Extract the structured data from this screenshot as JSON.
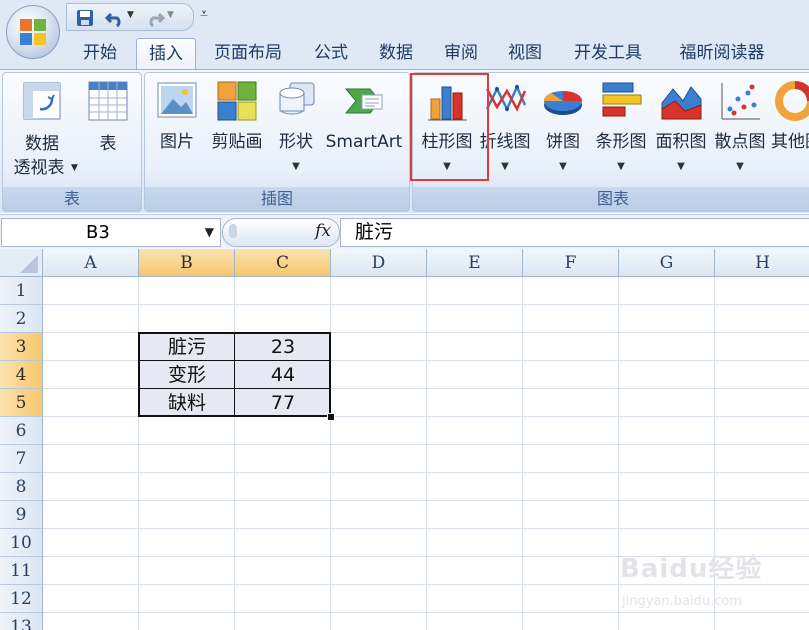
{
  "quick_access": {
    "items": [
      "save-icon",
      "undo-icon",
      "redo-icon",
      "customize-icon"
    ]
  },
  "tabs": [
    {
      "label": "开始"
    },
    {
      "label": "插入"
    },
    {
      "label": "页面布局"
    },
    {
      "label": "公式"
    },
    {
      "label": "数据"
    },
    {
      "label": "审阅"
    },
    {
      "label": "视图"
    },
    {
      "label": "开发工具"
    },
    {
      "label": "福昕阅读器"
    }
  ],
  "active_tab": "插入",
  "ribbon": {
    "groups": {
      "tables": {
        "label": "表",
        "pivot_label_1": "数据",
        "pivot_label_2": "透视表",
        "table_label": "表"
      },
      "illustrations": {
        "label": "插图",
        "picture_label": "图片",
        "clipart_label": "剪贴画",
        "shapes_label": "形状",
        "smartart_label": "SmartArt"
      },
      "charts": {
        "label": "图表",
        "column_label": "柱形图",
        "line_label": "折线图",
        "pie_label": "饼图",
        "bar_label": "条形图",
        "area_label": "面积图",
        "scatter_label": "散点图",
        "other_label": "其他图"
      }
    }
  },
  "formula_bar": {
    "name_box": "B3",
    "fx_label": "fx",
    "content": "脏污"
  },
  "grid": {
    "columns": [
      "A",
      "B",
      "C",
      "D",
      "E",
      "F",
      "G",
      "H"
    ],
    "rows": [
      "1",
      "2",
      "3",
      "4",
      "5",
      "6",
      "7",
      "8",
      "9",
      "10",
      "11",
      "12",
      "13"
    ],
    "cells": {
      "B3": "脏污",
      "C3": "23",
      "B4": "变形",
      "C4": "44",
      "B5": "缺料",
      "C5": "77"
    }
  },
  "watermark": {
    "brand": "Baidu经验",
    "url": "jingyan.baidu.com"
  },
  "colors": {
    "highlight": "#e03a3a",
    "selected_header": "#f6c76e",
    "ribbon_bg": "#dbe7f5"
  }
}
